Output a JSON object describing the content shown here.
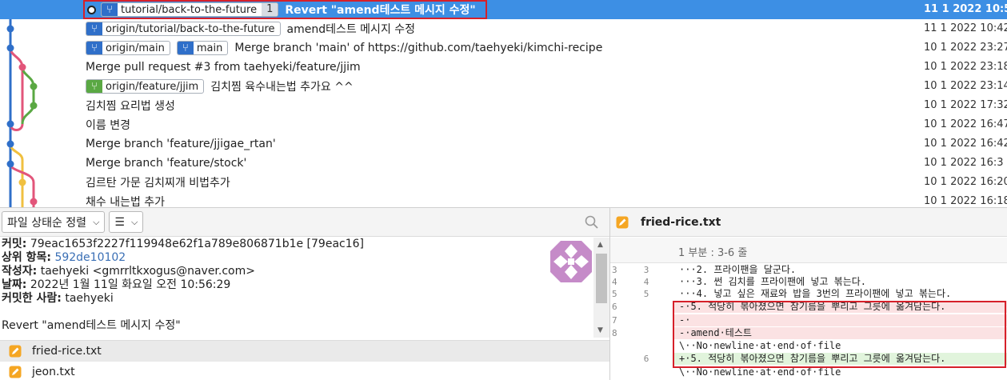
{
  "commits": [
    {
      "tags": [
        {
          "label": "tutorial/back-to-the-future",
          "count": "1",
          "color": "blue"
        }
      ],
      "message": "Revert \"amend테스트 메시지 수정\"",
      "date": "11 1 2022 10:5",
      "selected": true
    },
    {
      "tags": [
        {
          "label": "origin/tutorial/back-to-the-future",
          "color": "blue"
        }
      ],
      "message": "amend테스트 메시지 수정",
      "date": "11 1 2022 10:42"
    },
    {
      "tags": [
        {
          "label": "origin/main",
          "color": "blue"
        },
        {
          "label": "main",
          "color": "blue"
        }
      ],
      "message": "Merge branch 'main' of https://github.com/taehyeki/kimchi-recipe",
      "date": "10 1 2022 23:27"
    },
    {
      "tags": [],
      "message": "Merge pull request #3 from taehyeki/feature/jjim",
      "date": "10 1 2022 23:18"
    },
    {
      "tags": [
        {
          "label": "origin/feature/jjim",
          "color": "green"
        }
      ],
      "message": "김치찜 육수내는법 추가요 ^^",
      "date": "10 1 2022 23:14"
    },
    {
      "tags": [],
      "message": "김치찜 요리법 생성",
      "date": "10 1 2022 17:32"
    },
    {
      "tags": [],
      "message": "이름 변경",
      "date": "10 1 2022 16:47"
    },
    {
      "tags": [],
      "message": "Merge branch 'feature/jjigae_rtan'",
      "date": "10 1 2022 16:42"
    },
    {
      "tags": [],
      "message": "Merge branch 'feature/stock'",
      "date": "10 1 2022 16:3"
    },
    {
      "tags": [],
      "message": "김르탄 가문 김치찌개 비법추가",
      "date": "10 1 2022 16:20"
    },
    {
      "tags": [],
      "message": "채수 내는법 추가",
      "date": "10 1 2022 16:18"
    }
  ],
  "toolbar": {
    "sort_label": "파일 상태순 정렬",
    "view_label": "☰",
    "chevron": "⌄",
    "search_icon": "search-icon"
  },
  "details": {
    "commit_key": "커밋:",
    "commit_val": "79eac1653f2227f119948e62f1a789e806871b1e [79eac16]",
    "parent_key": "상위 항목:",
    "parent_val": "592de10102",
    "author_key": "작성자:",
    "author_val": "taehyeki <gmrrltkxogus@naver.com>",
    "date_key": "날짜:",
    "date_val": "2022년 1월 11일 화요일 오전 10:56:29",
    "committer_key": "커밋한 사람:",
    "committer_val": "taehyeki",
    "message": "Revert \"amend테스트 메시지 수정\""
  },
  "files": [
    {
      "name": "fried-rice.txt",
      "selected": true
    },
    {
      "name": "jeon.txt",
      "selected": false
    }
  ],
  "diff": {
    "filename": "fried-rice.txt",
    "hunk_header": "1 부분 : 3-6 줄",
    "lines": [
      {
        "n1": "3",
        "n2": "3",
        "type": "ctx",
        "text": "···2. 프라이팬을 달군다."
      },
      {
        "n1": "4",
        "n2": "4",
        "type": "ctx",
        "text": "···3. 썬 김치를 프라이팬에 넣고 볶는다."
      },
      {
        "n1": "5",
        "n2": "5",
        "type": "ctx",
        "text": "···4. 넣고 싶은 재료와 밥을 3번의 프라이팬에 넣고 볶는다."
      },
      {
        "n1": "6",
        "n2": "",
        "type": "del",
        "text": "-·5. 적당히 볶아졌으면 참기름을 뿌리고 그릇에 옮겨담는다."
      },
      {
        "n1": "7",
        "n2": "",
        "type": "del",
        "text": "-·"
      },
      {
        "n1": "8",
        "n2": "",
        "type": "del",
        "text": "-·amend·테스트"
      },
      {
        "n1": "",
        "n2": "",
        "type": "ctx",
        "text": "\\··No·newline·at·end·of·file"
      },
      {
        "n1": "",
        "n2": "6",
        "type": "add",
        "text": "+·5. 적당히 볶아졌으면 참기름을 뿌리고 그릇에 옮겨담는다."
      },
      {
        "n1": "",
        "n2": "",
        "type": "ctx",
        "text": "\\··No·newline·at·end·of·file"
      }
    ]
  },
  "colors": {
    "selection": "#3d8fe4",
    "branch_blue": "#2f6fc9",
    "branch_green": "#5aa843",
    "graph_pink": "#e2557a",
    "graph_yellow": "#f0c040",
    "highlight_red": "#d6202a"
  }
}
